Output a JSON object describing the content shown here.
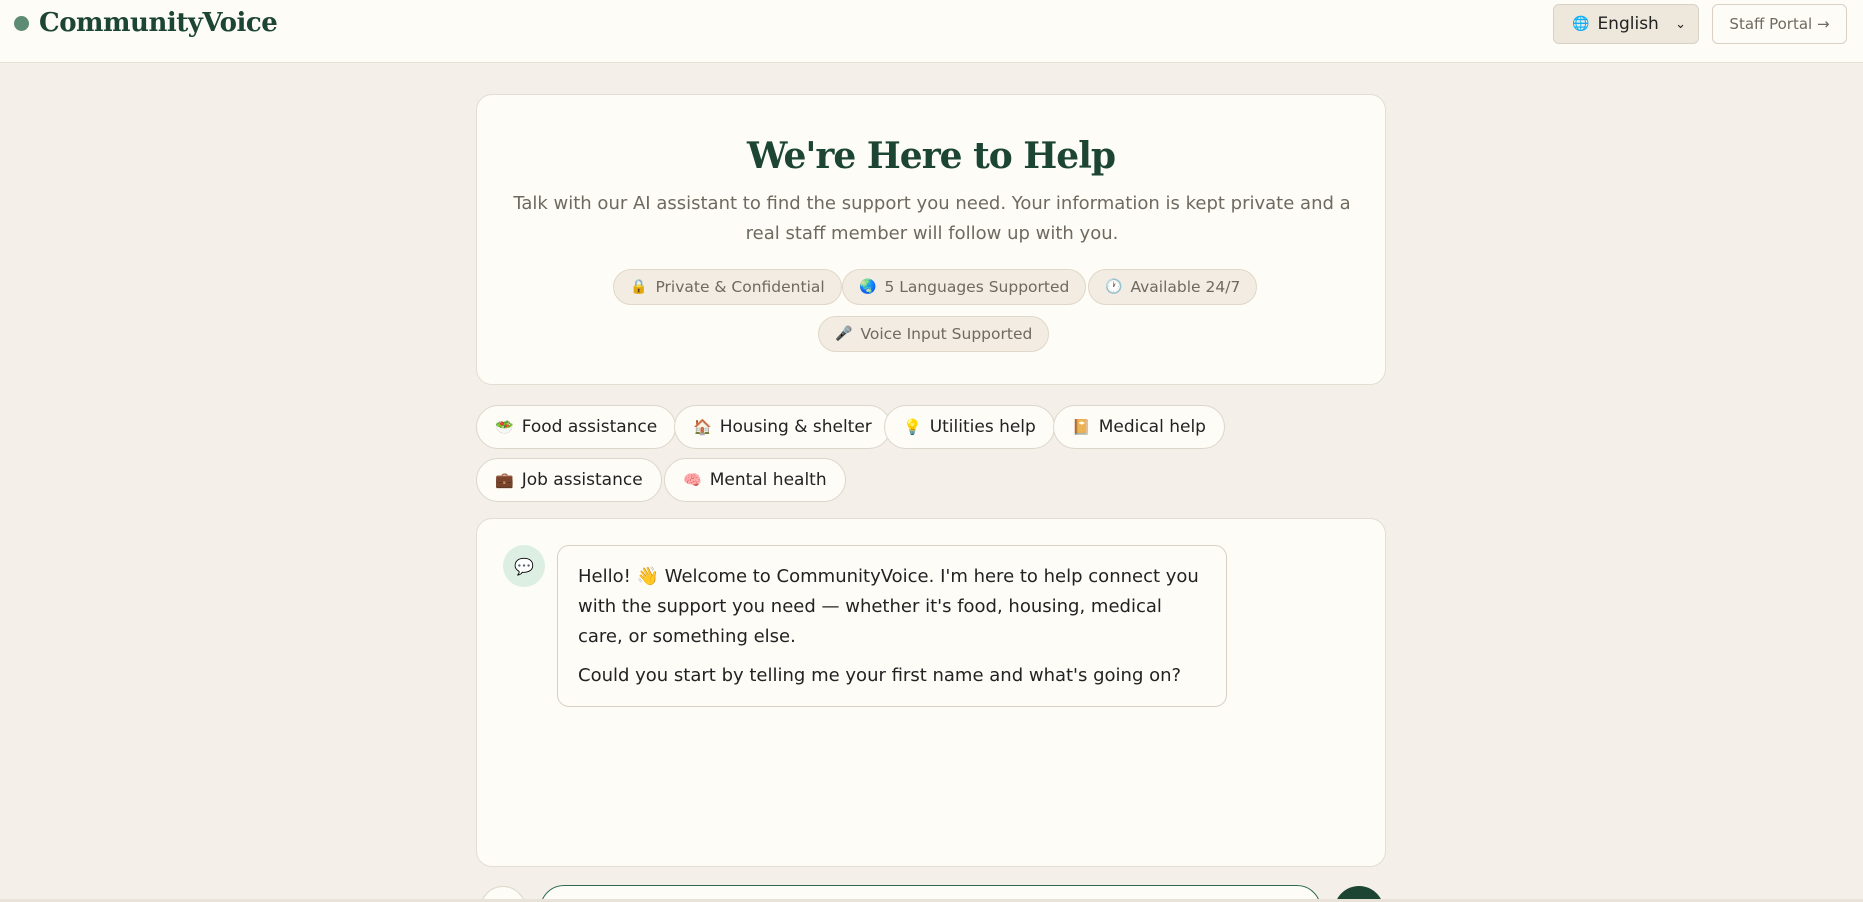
{
  "header": {
    "brand": "CommunityVoice",
    "language": {
      "icon": "globe-icon",
      "glyph": "🌐",
      "selected": "English"
    },
    "staff_portal": "Staff Portal →"
  },
  "intro": {
    "title": "We're Here to Help",
    "subtitle": "Talk with our AI assistant to find the support you need. Your information is kept private and a real staff member will follow up with you.",
    "badges": [
      {
        "icon": "lock-icon",
        "glyph": "🔒",
        "label": "Private & Confidential"
      },
      {
        "icon": "globe-icon",
        "glyph": "🌏",
        "label": "5 Languages Supported"
      },
      {
        "icon": "clock-icon",
        "glyph": "🕐",
        "label": "Available 24/7"
      },
      {
        "icon": "microphone-icon",
        "glyph": "🎤",
        "label": "Voice Input Supported"
      }
    ]
  },
  "topics": [
    {
      "icon": "food-bowl-icon",
      "glyph": "🥗",
      "label": "Food assistance"
    },
    {
      "icon": "house-icon",
      "glyph": "🏠",
      "label": "Housing & shelter"
    },
    {
      "icon": "lightbulb-icon",
      "glyph": "💡",
      "label": "Utilities help"
    },
    {
      "icon": "medical-book-icon",
      "glyph": "📔",
      "label": "Medical help"
    },
    {
      "icon": "briefcase-icon",
      "glyph": "💼",
      "label": "Job assistance"
    },
    {
      "icon": "brain-icon",
      "glyph": "🧠",
      "label": "Mental health"
    }
  ],
  "chat": {
    "avatar": {
      "icon": "speech-bubble-icon",
      "glyph": "💬"
    },
    "messages": [
      {
        "line1": "Hello! 👋 Welcome to CommunityVoice. I'm here to help connect you with the support you need — whether it's food, housing, medical care, or something else.",
        "line2": "Could you start by telling me your first name and what's going on?"
      }
    ]
  },
  "colors": {
    "brand_green": "#1c4533",
    "accent_green": "#5d8b74",
    "page_bg": "#f4efe8",
    "card_bg": "#fdfcf7"
  }
}
